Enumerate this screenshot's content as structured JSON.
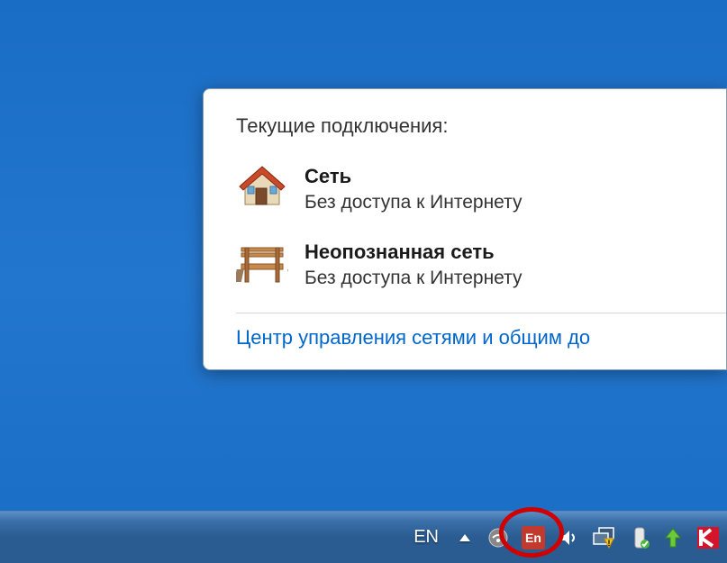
{
  "popup": {
    "title": "Текущие подключения:",
    "connections": [
      {
        "name": "Сеть",
        "status": "Без доступа к Интернету",
        "icon": "house-icon"
      },
      {
        "name": "Неопознанная сеть",
        "status": "Без доступа к Интернету",
        "icon": "bench-icon"
      }
    ],
    "networkCenterLink": "Центр управления сетями и общим до"
  },
  "taskbar": {
    "language": "EN",
    "enBadge": "En"
  }
}
